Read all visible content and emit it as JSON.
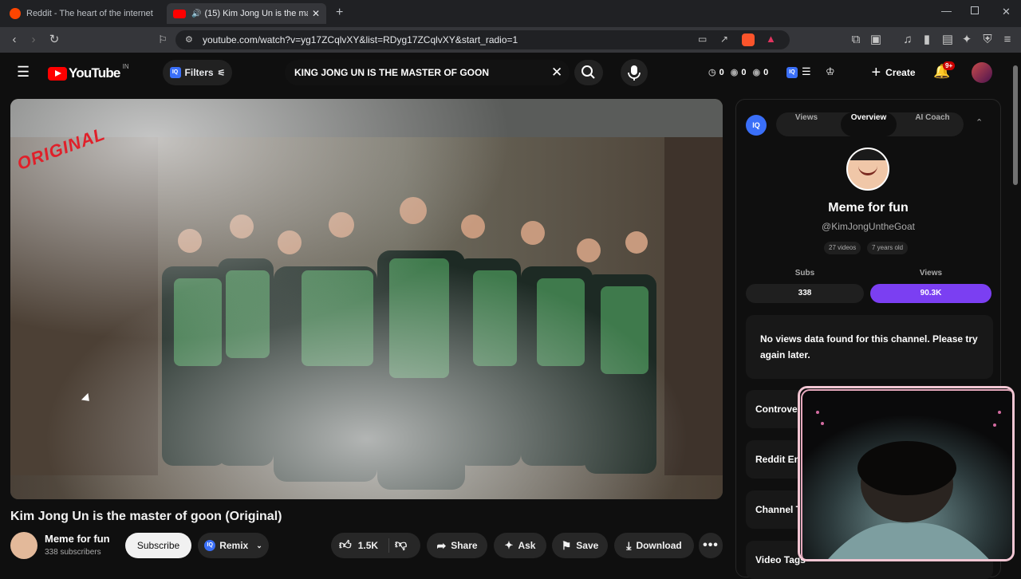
{
  "browser": {
    "tabs": [
      {
        "title": "Reddit - The heart of the internet",
        "favicon_color": "#ff4500"
      },
      {
        "title": "(15) Kim Jong Un is the maste",
        "favicon_color": "#ff0000"
      }
    ],
    "new_tab": "+",
    "url": "youtube.com/watch?v=yg17ZCqlvXY&list=RDyg17ZCqlvXY&start_radio=1"
  },
  "youtube": {
    "logo_text": "YouTube",
    "region": "IN",
    "filters_label": "Filters",
    "iq_badge": "IQ",
    "search_query": "KING JONG UN IS THE MASTER OF GOON",
    "stats": [
      "0",
      "0",
      "0"
    ],
    "create_label": "Create",
    "notification_count": "9+"
  },
  "video": {
    "overlay_text": "ORIGINAL",
    "title": "Kim Jong Un is the master of goon (Original)",
    "channel_name": "Meme for fun",
    "subscribers": "338 subscribers",
    "subscribe_label": "Subscribe",
    "remix_label": "Remix",
    "likes": "1.5K",
    "share_label": "Share",
    "ask_label": "Ask",
    "save_label": "Save",
    "download_label": "Download"
  },
  "panel": {
    "tabs": [
      "Views",
      "Overview",
      "AI Coach"
    ],
    "active_tab": "Overview",
    "channel_name": "Meme for fun",
    "handle": "@KimJongUntheGoat",
    "videos": "27 videos",
    "age": "7 years old",
    "subs_label": "Subs",
    "subs_value": "338",
    "views_label": "Views",
    "views_value": "90.3K",
    "no_data_msg": "No views data found for this channel. Please try again later.",
    "sections": [
      "Controver",
      "Reddit En",
      "Channel T",
      "Video Tags"
    ]
  },
  "colors": {
    "accent_purple": "#7b3ff2",
    "yt_red": "#ff0000",
    "iq_blue": "#3a6ff8"
  }
}
